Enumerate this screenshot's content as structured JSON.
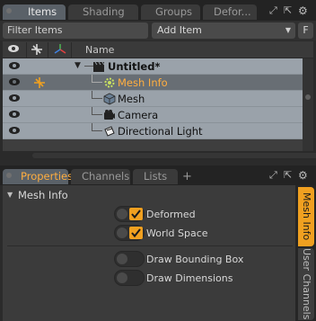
{
  "top_tabs": [
    {
      "label": "Items",
      "active": true
    },
    {
      "label": "Shading",
      "active": false
    },
    {
      "label": "Groups",
      "active": false
    },
    {
      "label": "Defor...",
      "active": false
    }
  ],
  "top_window_icons": [
    "expand-icon",
    "popout-icon",
    "gear-icon"
  ],
  "filter": {
    "placeholder": "Filter Items",
    "add_item": "Add Item",
    "f_button": "F"
  },
  "list": {
    "header_name": "Name",
    "rows": [
      {
        "label": "Untitled*",
        "icon": "clapper-icon",
        "selected": false
      },
      {
        "label": "Mesh Info",
        "icon": "gear-icon",
        "selected": true
      },
      {
        "label": "Mesh",
        "icon": "cube-icon",
        "selected": false
      },
      {
        "label": "Camera",
        "icon": "camera-icon",
        "selected": false
      },
      {
        "label": "Directional Light",
        "icon": "light-icon",
        "selected": false
      }
    ]
  },
  "bottom_tabs": [
    {
      "label": "Properties",
      "active": true
    },
    {
      "label": "Channels",
      "active": false
    },
    {
      "label": "Lists",
      "active": false
    }
  ],
  "add_tab_symbol": "+",
  "properties": {
    "section_title": "Mesh Info",
    "items": [
      {
        "label": "Deformed",
        "checked": true
      },
      {
        "label": "World Space",
        "checked": true
      },
      {
        "label": "Draw Bounding Box",
        "checked": false
      },
      {
        "label": "Draw Dimensions",
        "checked": false
      }
    ]
  },
  "vertical_tabs": [
    {
      "label": "Mesh Info",
      "active": true
    },
    {
      "label": "User Channels",
      "active": false
    }
  ],
  "colors": {
    "accent": "#f0a020",
    "selected_text": "#ffae40",
    "row_bg": "#9aa2aa",
    "row_selected_bg": "#686e74"
  }
}
